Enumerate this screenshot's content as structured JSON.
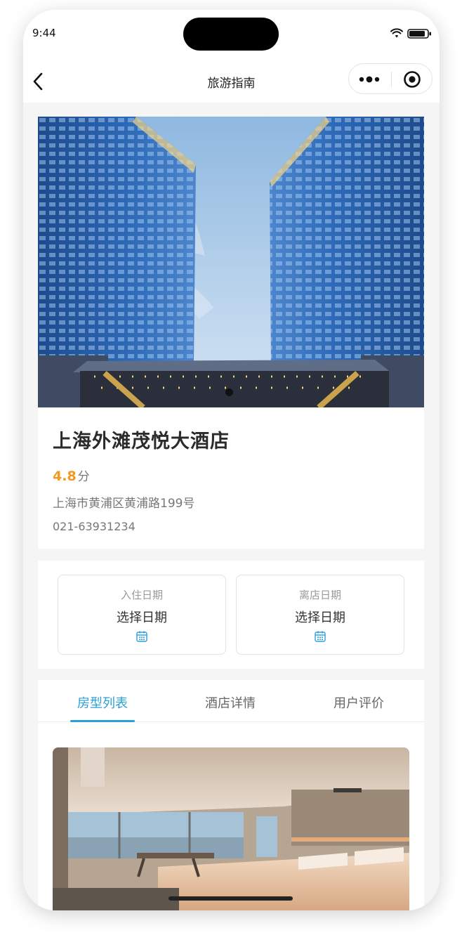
{
  "status_bar": {
    "time": "9:44"
  },
  "nav": {
    "title": "旅游指南"
  },
  "hotel": {
    "name": "上海外滩茂悦大酒店",
    "rating": "4.8",
    "rating_unit": "分",
    "address": "上海市黄浦区黄浦路199号",
    "phone": "021-63931234"
  },
  "dates": {
    "checkin_label": "入住日期",
    "checkin_value": "选择日期",
    "checkout_label": "离店日期",
    "checkout_value": "选择日期"
  },
  "tabs": [
    {
      "label": "房型列表",
      "active": true
    },
    {
      "label": "酒店详情",
      "active": false
    },
    {
      "label": "用户评价",
      "active": false
    }
  ],
  "colors": {
    "accent": "#2a9fd8",
    "rating": "#f29a1d",
    "background": "#f5f5f5"
  },
  "icons": [
    "back-arrow-icon",
    "more-dots-icon",
    "target-icon",
    "wifi-icon",
    "battery-icon",
    "calendar-icon"
  ]
}
